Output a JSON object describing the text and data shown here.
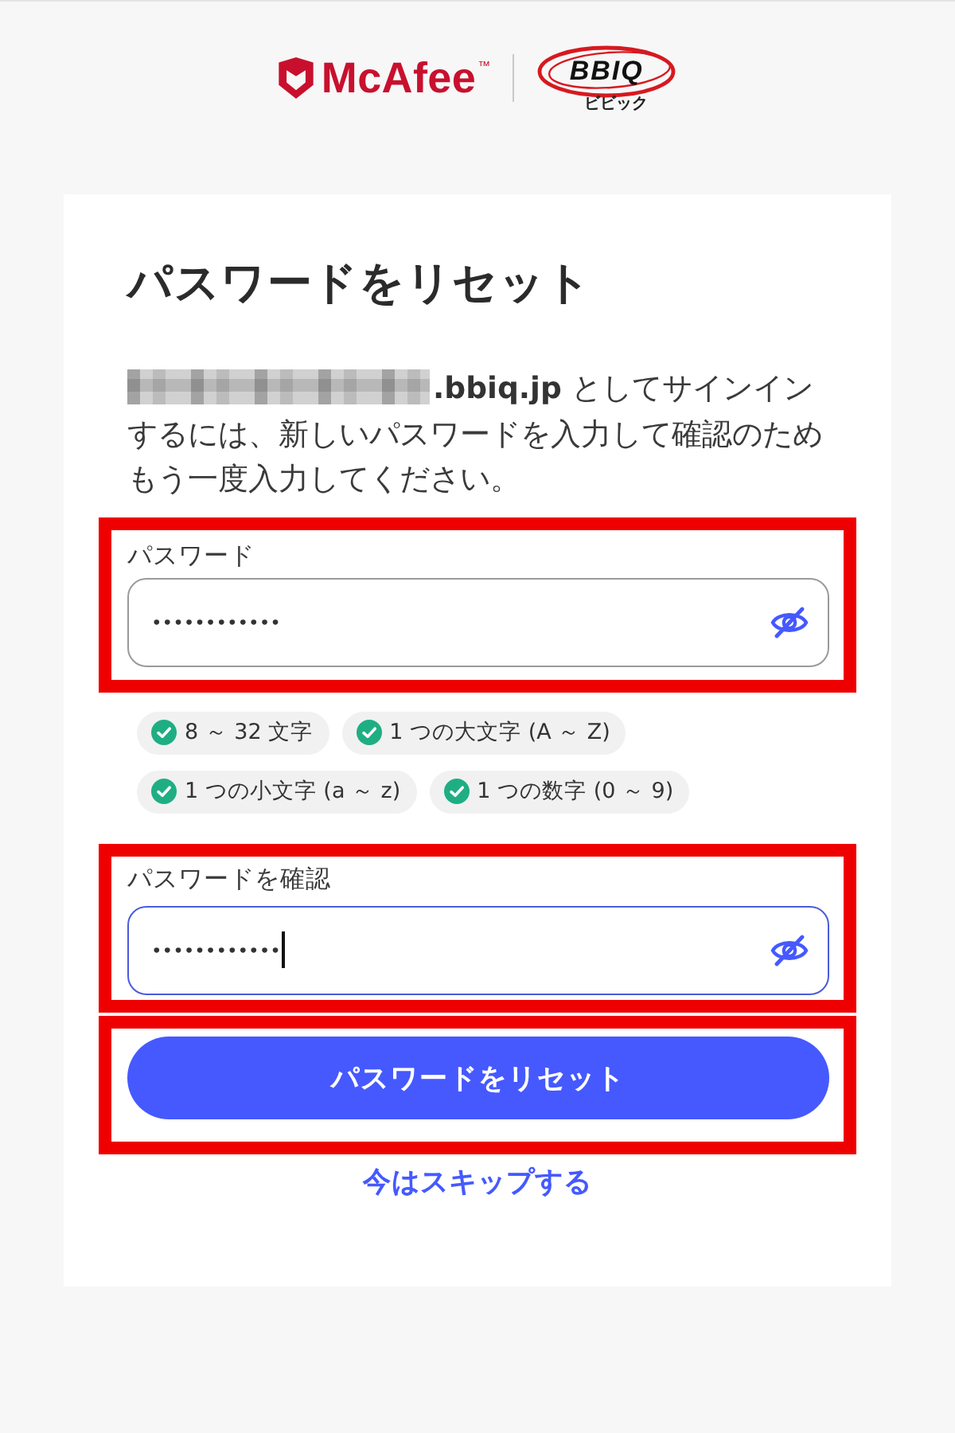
{
  "header": {
    "logos": [
      {
        "kind": "mcafee",
        "name": "McAfee",
        "mark": "™"
      },
      {
        "kind": "bbiq",
        "name": "BBIQ",
        "reading": "ビビック"
      }
    ]
  },
  "card": {
    "title": "パスワードをリセット",
    "email_redacted": true,
    "message": "**.bbiq.jp** としてサインインするには、新しいパスワードを入力して確認のためもう一度入力してください。",
    "password_field": {
      "label": "パスワード",
      "value": "••••••••••••",
      "focused": false,
      "highlighted": true
    },
    "requirements": [
      {
        "text": "8 ～ 32 文字",
        "met": true
      },
      {
        "text": "1 つの大文字 (A ～ Z)",
        "met": true
      },
      {
        "text": "1 つの小文字 (a ～ z)",
        "met": true
      },
      {
        "text": "1 つの数字 (0 ～ 9)",
        "met": true
      }
    ],
    "confirm_field": {
      "label": "パスワードを確認",
      "value": "••••••••••••",
      "focused": true,
      "highlighted": true
    },
    "submit": {
      "label": "パスワードをリセット",
      "highlighted": true
    },
    "skip_link": "今はスキップする"
  }
}
